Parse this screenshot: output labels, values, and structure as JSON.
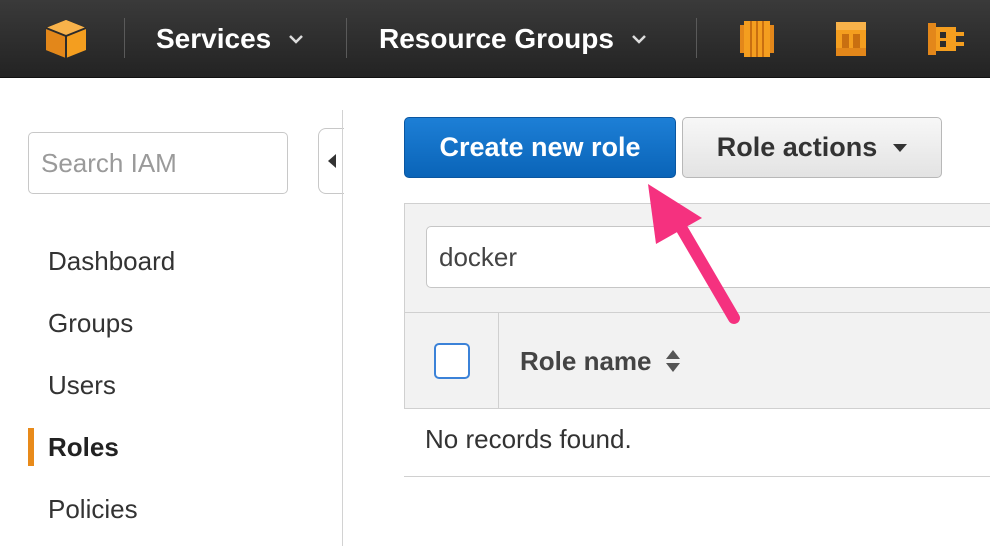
{
  "topbar": {
    "menus": [
      {
        "label": "Services"
      },
      {
        "label": "Resource Groups"
      }
    ],
    "shortcuts": [
      "ec2-icon",
      "lambda-icon",
      "ecs-icon"
    ],
    "colors": {
      "bar": "#2b2b2b",
      "accent": "#f49e1f"
    }
  },
  "sidebar": {
    "search_placeholder": "Search IAM",
    "items": [
      {
        "label": "Dashboard",
        "active": false
      },
      {
        "label": "Groups",
        "active": false
      },
      {
        "label": "Users",
        "active": false
      },
      {
        "label": "Roles",
        "active": true
      },
      {
        "label": "Policies",
        "active": false
      }
    ],
    "active_indicator_color": "#e88a1a"
  },
  "toolbar": {
    "create_label": "Create new role",
    "actions_label": "Role actions",
    "primary_color": "#0f6fc6"
  },
  "table": {
    "filter_value": "docker",
    "columns": [
      {
        "label": "Role name",
        "sortable": true
      }
    ],
    "empty_message": "No records found."
  },
  "annotation": {
    "color": "#f5317f"
  }
}
